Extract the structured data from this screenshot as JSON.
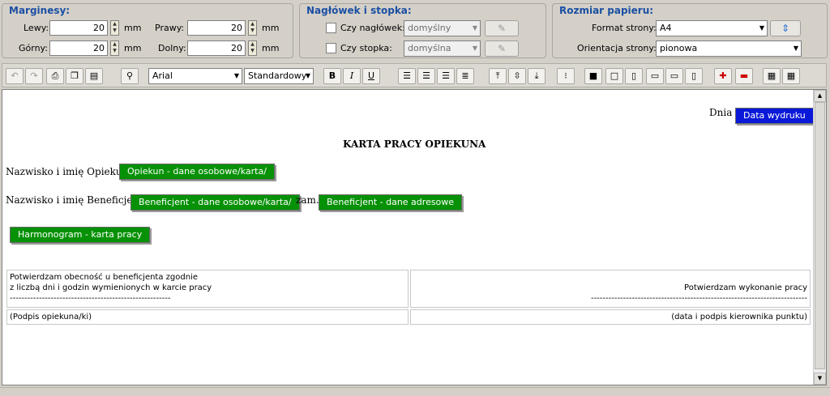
{
  "margins": {
    "title": "Marginesy:",
    "left_label": "Lewy:",
    "left_value": "20",
    "right_label": "Prawy:",
    "right_value": "20",
    "top_label": "Górny:",
    "top_value": "20",
    "bottom_label": "Dolny:",
    "bottom_value": "20",
    "unit": "mm"
  },
  "header_footer": {
    "title": "Nagłówek i stopka:",
    "header_label": "Czy nagłówek:",
    "header_value": "domyślny",
    "footer_label": "Czy stopka:",
    "footer_value": "domyślna"
  },
  "paper": {
    "title": "Rozmiar papieru:",
    "format_label": "Format strony:",
    "format_value": "A4",
    "orientation_label": "Orientacja strony:",
    "orientation_value": "pionowa"
  },
  "toolbar": {
    "font_value": "Arial",
    "size_value": "Standardowy",
    "bold": "B",
    "italic": "I",
    "underline": "U"
  },
  "document": {
    "date_label": "Dnia",
    "date_field": "Data wydruku",
    "title": "KARTA PRACY OPIEKUNA",
    "caregiver_label": "Nazwisko i imię Opiekuna:",
    "caregiver_field": "Opiekun - dane osobowe/karta/",
    "beneficiary_label": "Nazwisko i imię Beneficjenta:",
    "beneficiary_field": "Beneficjent - dane osobowe/karta/",
    "address_label": "zam.",
    "address_field": "Beneficjent - dane adresowe",
    "schedule_field": "Harmonogram - karta pracy",
    "table": {
      "left_line1": "Potwierdzam obecność u beneficjenta zgodnie",
      "left_line2": "z liczbą dni i godzin wymienionych w karcie pracy",
      "left_dashes": "-------------------------------------------------------",
      "right_line": "Potwierdzam wykonanie pracy",
      "right_dashes": "--------------------------------------------------------------------------",
      "left_sign": "(Podpis opiekuna/ki)",
      "right_sign": "(data i podpis kierownika punktu)"
    }
  },
  "colors": {
    "field_green": "#079107",
    "field_blue": "#0a18d8",
    "panel_title": "#1b4fa3"
  }
}
